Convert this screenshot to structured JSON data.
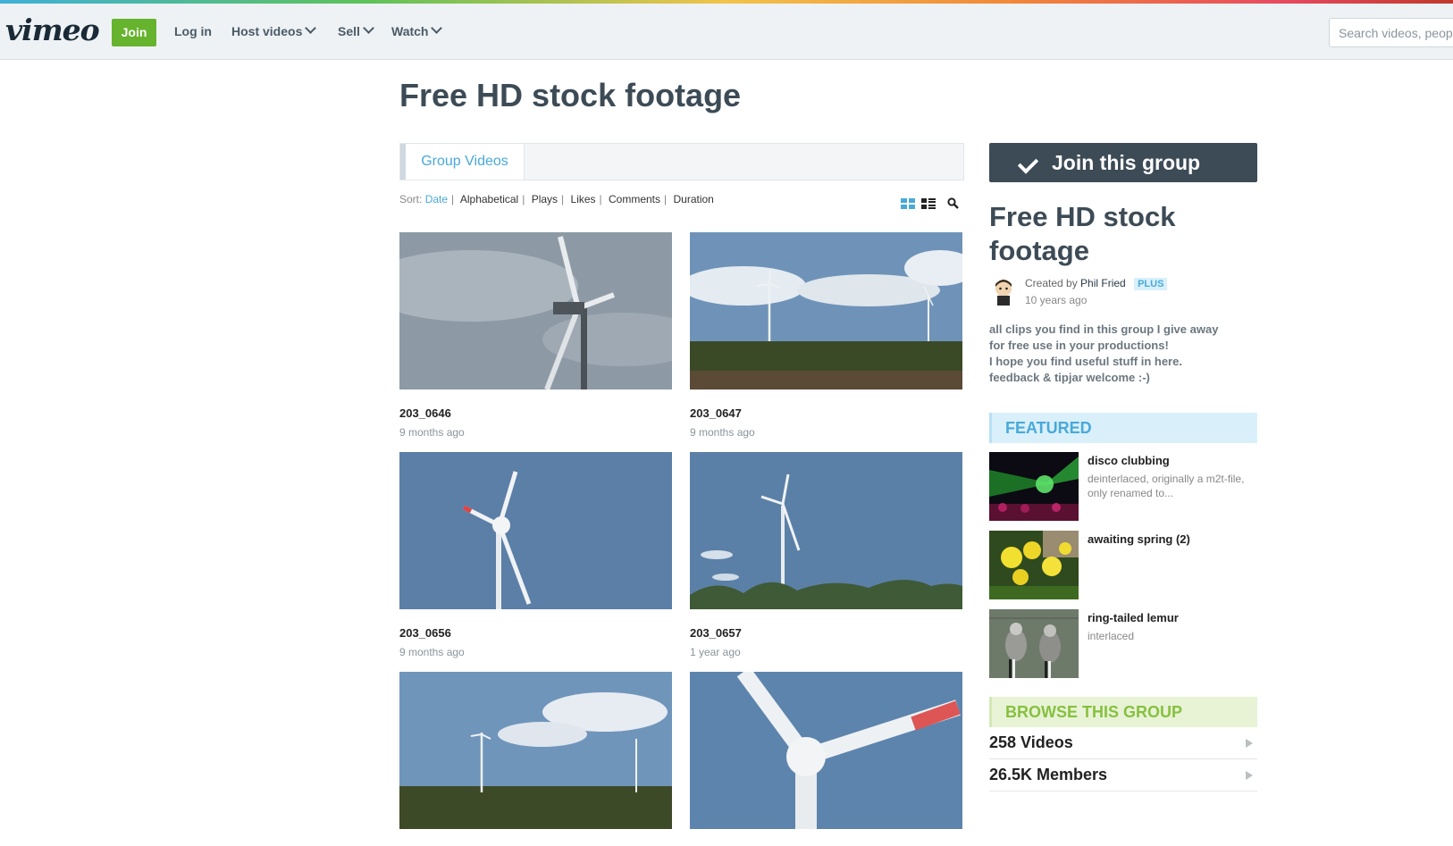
{
  "header": {
    "logo": "vimeo",
    "join": "Join",
    "login": "Log in",
    "host_videos": "Host videos",
    "sell": "Sell",
    "watch": "Watch",
    "search_placeholder": "Search videos, peop"
  },
  "page": {
    "title": "Free HD stock footage"
  },
  "tabs": {
    "group_videos": "Group Videos"
  },
  "sort": {
    "label": "Sort:",
    "options": [
      "Date",
      "Alphabetical",
      "Plays",
      "Likes",
      "Comments",
      "Duration"
    ],
    "active": "Date"
  },
  "videos": [
    {
      "title": "203_0646",
      "meta": "9 months ago"
    },
    {
      "title": "203_0647",
      "meta": "9 months ago"
    },
    {
      "title": "203_0656",
      "meta": "9 months ago"
    },
    {
      "title": "203_0657",
      "meta": "1 year ago"
    },
    {
      "title": "",
      "meta": ""
    },
    {
      "title": "",
      "meta": ""
    }
  ],
  "sidebar": {
    "join_group": "Join this group",
    "group_title": "Free HD stock footage",
    "created_by": "Created by",
    "creator": "Phil Fried",
    "badge": "PLUS",
    "created_ago": "10 years ago",
    "description": [
      "all clips you find in this group I give away",
      "for free use in your productions!",
      "I hope you find useful stuff in here.",
      "feedback & tipjar welcome :-)"
    ],
    "featured_heading": "FEATURED",
    "featured": [
      {
        "title": "disco clubbing",
        "desc": "deinterlaced, originally a m2t-file, only renamed to..."
      },
      {
        "title": "awaiting spring (2)",
        "desc": ""
      },
      {
        "title": "ring-tailed lemur",
        "desc": "interlaced"
      }
    ],
    "browse_heading": "BROWSE THIS GROUP",
    "browse": [
      {
        "label": "258 Videos"
      },
      {
        "label": "26.5K Members"
      }
    ]
  },
  "colors": {
    "accent": "#49a9d9",
    "join_green": "#66b32e",
    "dark_button": "#3d4b56"
  }
}
